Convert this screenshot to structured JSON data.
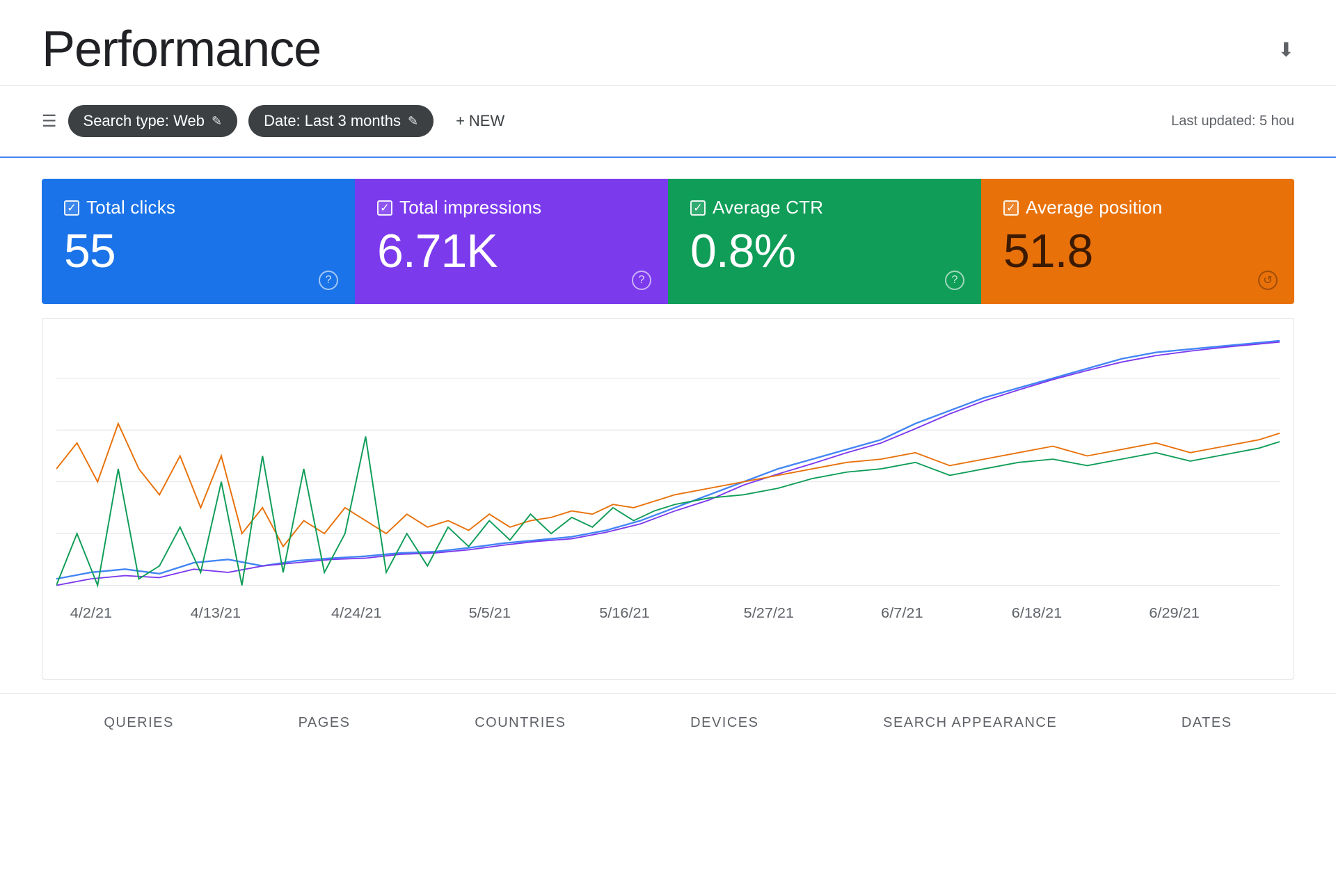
{
  "page": {
    "title": "Performance"
  },
  "toolbar": {
    "search_type_label": "Search type: Web",
    "date_label": "Date: Last 3 months",
    "new_label": "NEW",
    "last_updated": "Last updated: 5 hou"
  },
  "metrics": [
    {
      "id": "clicks",
      "label": "Total clicks",
      "value": "55",
      "color": "#1a73e8"
    },
    {
      "id": "impressions",
      "label": "Total impressions",
      "value": "6.71K",
      "color": "#7c3aed"
    },
    {
      "id": "ctr",
      "label": "Average CTR",
      "value": "0.8%",
      "color": "#0f9d58"
    },
    {
      "id": "position",
      "label": "Average position",
      "value": "51.8",
      "color": "#e8710a"
    }
  ],
  "chart": {
    "x_labels": [
      "4/2/21",
      "4/13/21",
      "4/24/21",
      "5/5/21",
      "5/16/21",
      "5/27/21",
      "6/7/21",
      "6/18/21",
      "6/29/21"
    ],
    "series": [
      {
        "name": "Total clicks",
        "color": "#4285f4"
      },
      {
        "name": "Total impressions",
        "color": "#7c3aed"
      },
      {
        "name": "Average CTR",
        "color": "#e8710a"
      },
      {
        "name": "Average position",
        "color": "#0f9d58"
      }
    ]
  },
  "bottom_tabs": [
    {
      "label": "QUERIES"
    },
    {
      "label": "PAGES"
    },
    {
      "label": "COUNTRIES"
    },
    {
      "label": "DEVICES"
    },
    {
      "label": "SEARCH APPEARANCE"
    },
    {
      "label": "DATES"
    }
  ],
  "icons": {
    "filter": "☰",
    "edit": "✎",
    "plus": "+",
    "download": "⬇",
    "check": "✓",
    "question": "?"
  }
}
